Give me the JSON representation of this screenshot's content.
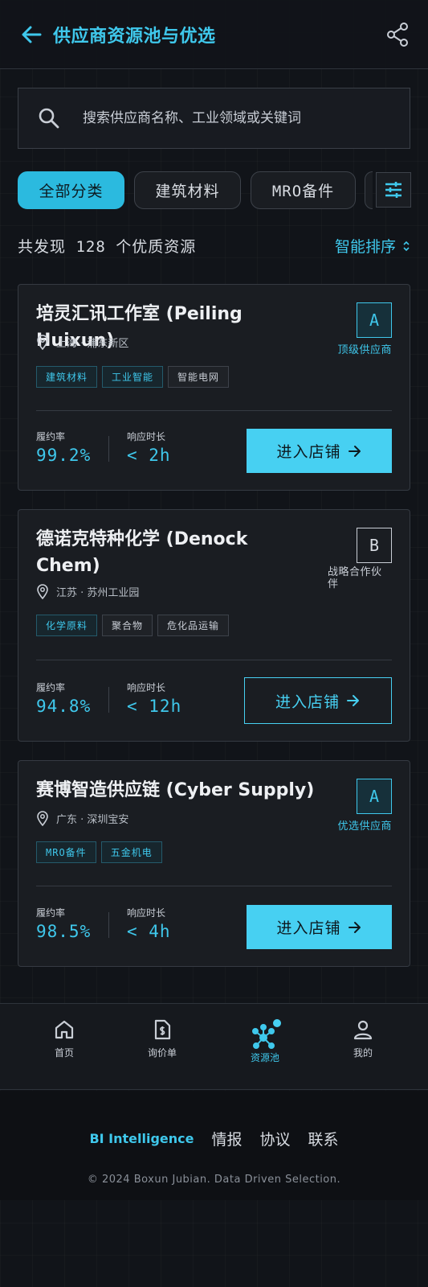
{
  "header": {
    "title": "供应商资源池与优选"
  },
  "search": {
    "placeholder": "搜索供应商名称、工业领域或关键词"
  },
  "filters": [
    {
      "label": "全部分类",
      "active": true
    },
    {
      "label": "建筑材料",
      "active": false
    },
    {
      "label": "MRO备件",
      "active": false
    }
  ],
  "results": {
    "count_text": "共发现 128 个优质资源",
    "sort_label": "智能排序"
  },
  "suppliers": [
    {
      "name": "培灵汇讯工作室 (Peiling Huixun)",
      "location": "上海 · 浦东新区",
      "grade": "A",
      "grade_label": "顶级供应商",
      "tags": [
        "建筑材料",
        "工业智能",
        "智能电网"
      ],
      "fulfillment_label": "履约率",
      "fulfillment_value": "99.2%",
      "response_label": "响应时长",
      "response_value": "< 2h",
      "button_label": "进入店铺"
    },
    {
      "name": "德诺克特种化学 (Denock Chem)",
      "location": "江苏 · 苏州工业园",
      "grade": "B",
      "grade_label": "战略合作伙伴",
      "tags": [
        "化学原料",
        "聚合物",
        "危化品运输"
      ],
      "fulfillment_label": "履约率",
      "fulfillment_value": "94.8%",
      "response_label": "响应时长",
      "response_value": "< 12h",
      "button_label": "进入店铺"
    },
    {
      "name": "赛博智造供应链 (Cyber Supply)",
      "location": "广东 · 深圳宝安",
      "grade": "A",
      "grade_label": "优选供应商",
      "tags": [
        "MRO备件",
        "五金机电"
      ],
      "fulfillment_label": "履约率",
      "fulfillment_value": "98.5%",
      "response_label": "响应时长",
      "response_value": "< 4h",
      "button_label": "进入店铺"
    }
  ],
  "nav": [
    {
      "label": "首页",
      "icon": "home-icon"
    },
    {
      "label": "询价单",
      "icon": "quote-document-icon"
    },
    {
      "label": "资源池",
      "icon": "network-icon",
      "active": true
    },
    {
      "label": "我的",
      "icon": "user-icon"
    }
  ],
  "footer": {
    "brand": "BI Intelligence",
    "links": [
      "情报",
      "协议",
      "联系"
    ],
    "copyright": "© 2024 Boxun Jubian. Data Driven Selection."
  },
  "colors": {
    "accent": "#3fc8ec",
    "background": "#111419",
    "card": "#1a1d22"
  }
}
